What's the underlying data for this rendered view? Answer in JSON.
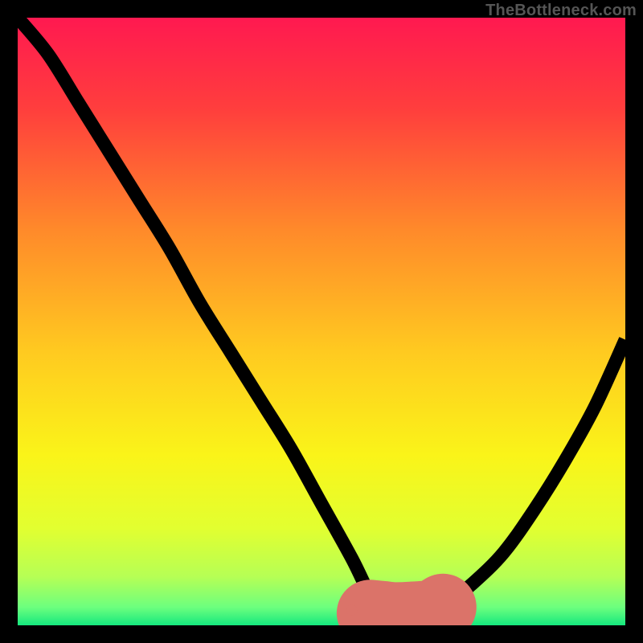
{
  "watermark": "TheBottleneck.com",
  "chart_data": {
    "type": "line",
    "title": "",
    "xlabel": "",
    "ylabel": "",
    "xlim": [
      0,
      100
    ],
    "ylim": [
      0,
      100
    ],
    "grid": false,
    "series": [
      {
        "name": "bottleneck-curve",
        "x": [
          0,
          5,
          10,
          15,
          20,
          25,
          30,
          35,
          40,
          45,
          50,
          55,
          58,
          60,
          62,
          65,
          68,
          70,
          75,
          80,
          85,
          90,
          95,
          100
        ],
        "values": [
          100,
          94,
          86,
          78,
          70,
          62,
          53,
          45,
          37,
          29,
          20,
          11,
          5,
          3,
          2,
          1,
          2,
          3,
          7,
          12,
          19,
          27,
          36,
          47
        ]
      },
      {
        "name": "optimal-range-highlight",
        "x": [
          55,
          58,
          60,
          62,
          65,
          68,
          70
        ],
        "values": [
          2.5,
          2,
          1.8,
          1.6,
          1.7,
          2,
          3
        ]
      }
    ],
    "gradient_stops": [
      {
        "offset": 0.0,
        "color": "#ff1950"
      },
      {
        "offset": 0.15,
        "color": "#ff3e3d"
      },
      {
        "offset": 0.35,
        "color": "#ff8a2a"
      },
      {
        "offset": 0.55,
        "color": "#ffca20"
      },
      {
        "offset": 0.72,
        "color": "#faf419"
      },
      {
        "offset": 0.84,
        "color": "#e2ff30"
      },
      {
        "offset": 0.92,
        "color": "#b6ff55"
      },
      {
        "offset": 0.97,
        "color": "#6dff7e"
      },
      {
        "offset": 1.0,
        "color": "#15e87e"
      }
    ],
    "colors": {
      "curve": "#000000",
      "highlight": "#db7369",
      "background_frame": "#000000"
    }
  }
}
